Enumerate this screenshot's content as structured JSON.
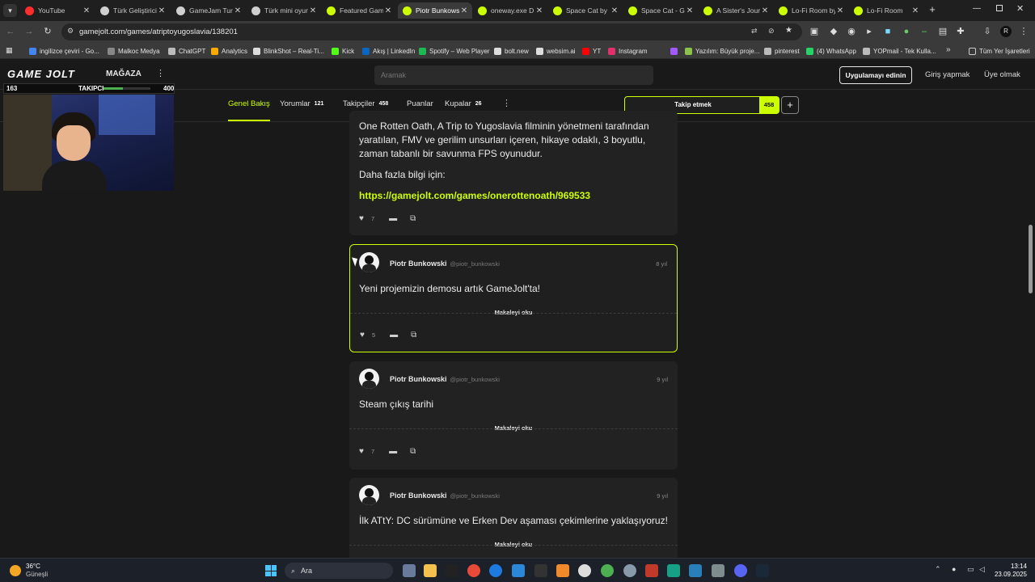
{
  "browser": {
    "tabs": [
      {
        "label": "YouTube",
        "color": "#ff2d2d"
      },
      {
        "label": "Türk Geliştirici",
        "color": "#cfcfcf"
      },
      {
        "label": "GameJam Turk",
        "color": "#cfcfcf"
      },
      {
        "label": "Türk mini oyun",
        "color": "#cfcfcf"
      },
      {
        "label": "Featured Gam",
        "color": "#ccff00"
      },
      {
        "label": "Piotr Bunkows",
        "color": "#ccff00",
        "active": true
      },
      {
        "label": "oneway.exe D",
        "color": "#ccff00"
      },
      {
        "label": "Space Cat by",
        "color": "#ccff00"
      },
      {
        "label": "Space Cat - Ga",
        "color": "#ccff00"
      },
      {
        "label": "A Sister's Jour",
        "color": "#ccff00"
      },
      {
        "label": "Lo-Fi Room by",
        "color": "#ccff00"
      },
      {
        "label": "Lo-Fi Room",
        "color": "#ccff00"
      }
    ],
    "url": "gamejolt.com/games/atriptoyugoslavia/138201",
    "bookmarks": [
      {
        "label": "ingilizce çeviri - Go...",
        "color": "#4285f4"
      },
      {
        "label": "Malkoc Medya",
        "color": "#888888"
      },
      {
        "label": "ChatGPT",
        "color": "#bbbbbb"
      },
      {
        "label": "Analytics",
        "color": "#f9ab00"
      },
      {
        "label": "BlinkShot – Real-Ti...",
        "color": "#dddddd"
      },
      {
        "label": "Kick",
        "color": "#53fc18"
      },
      {
        "label": "Akış | LinkedIn",
        "color": "#0a66c2"
      },
      {
        "label": "Spotify – Web Player",
        "color": "#1db954"
      },
      {
        "label": "bolt.new",
        "color": "#dddddd"
      },
      {
        "label": "websim.ai",
        "color": "#dddddd"
      },
      {
        "label": "YT",
        "color": "#ff0000"
      },
      {
        "label": "Instagram",
        "color": "#e1306c"
      },
      {
        "label": "Yazılım: Büyük proje...",
        "color": "#8bc34a"
      },
      {
        "label": "pinterest",
        "color": "#bbbbbb"
      },
      {
        "label": "(4) WhatsApp",
        "color": "#25d366"
      },
      {
        "label": "YOPmail - Tek Kulla...",
        "color": "#bbbbbb"
      }
    ],
    "all_bookmarks_label": "Tüm Yer İşaretleri"
  },
  "gamejolt": {
    "logo": "GAME JOLT",
    "store_label": "MAĞAZA",
    "search_placeholder": "Aramak",
    "get_app_label": "Uygulamayı edinin",
    "login_label": "Giriş yapmak",
    "signup_label": "Üye olmak",
    "nav": [
      {
        "label": "Genel Bakış",
        "count": "",
        "active": true
      },
      {
        "label": "Yorumlar",
        "count": "121"
      },
      {
        "label": "Takipçiler",
        "count": "458"
      },
      {
        "label": "Puanlar",
        "count": ""
      },
      {
        "label": "Kupalar",
        "count": "26"
      }
    ],
    "follow_label": "Takip etmek",
    "follow_count": "458"
  },
  "overlay": {
    "left_count": "163",
    "label": "TAKIPCI",
    "right_count": "400",
    "progress": 0.4075
  },
  "posts": [
    {
      "text1": "One Rotten Oath, A Trip to Yugoslavia filminin yönetmeni tarafından yaratılan, FMV ve gerilim unsurları içeren, hikaye odaklı, 3 boyutlu, zaman tabanlı bir savunma FPS oyunudur.",
      "text2": "Daha fazla bilgi için:",
      "link": "https://gamejolt.com/games/onerottenoath/969533",
      "likes": "7"
    },
    {
      "author": "Piotr Bunkowski",
      "handle": "@piotr_bunkowski",
      "age": "8 yıl",
      "text": "Yeni projemizin demosu artık GameJolt'ta!",
      "read_more": "Makaleyi oku",
      "likes": "5"
    },
    {
      "author": "Piotr Bunkowski",
      "handle": "@piotr_bunkowski",
      "age": "9 yıl",
      "text": "Steam çıkış tarihi",
      "read_more": "Makaleyi oku",
      "likes": "7"
    },
    {
      "author": "Piotr Bunkowski",
      "handle": "@piotr_bunkowski",
      "age": "9 yıl",
      "text": "İlk ATtY: DC sürümüne ve Erken Dev aşaması çekimlerine yaklaşıyoruz!",
      "read_more": "Makaleyi oku"
    }
  ],
  "taskbar": {
    "weather_temp": "36°C",
    "weather_desc": "Güneşli",
    "search_label": "Ara",
    "time": "13:14",
    "date": "23.09.2025"
  }
}
